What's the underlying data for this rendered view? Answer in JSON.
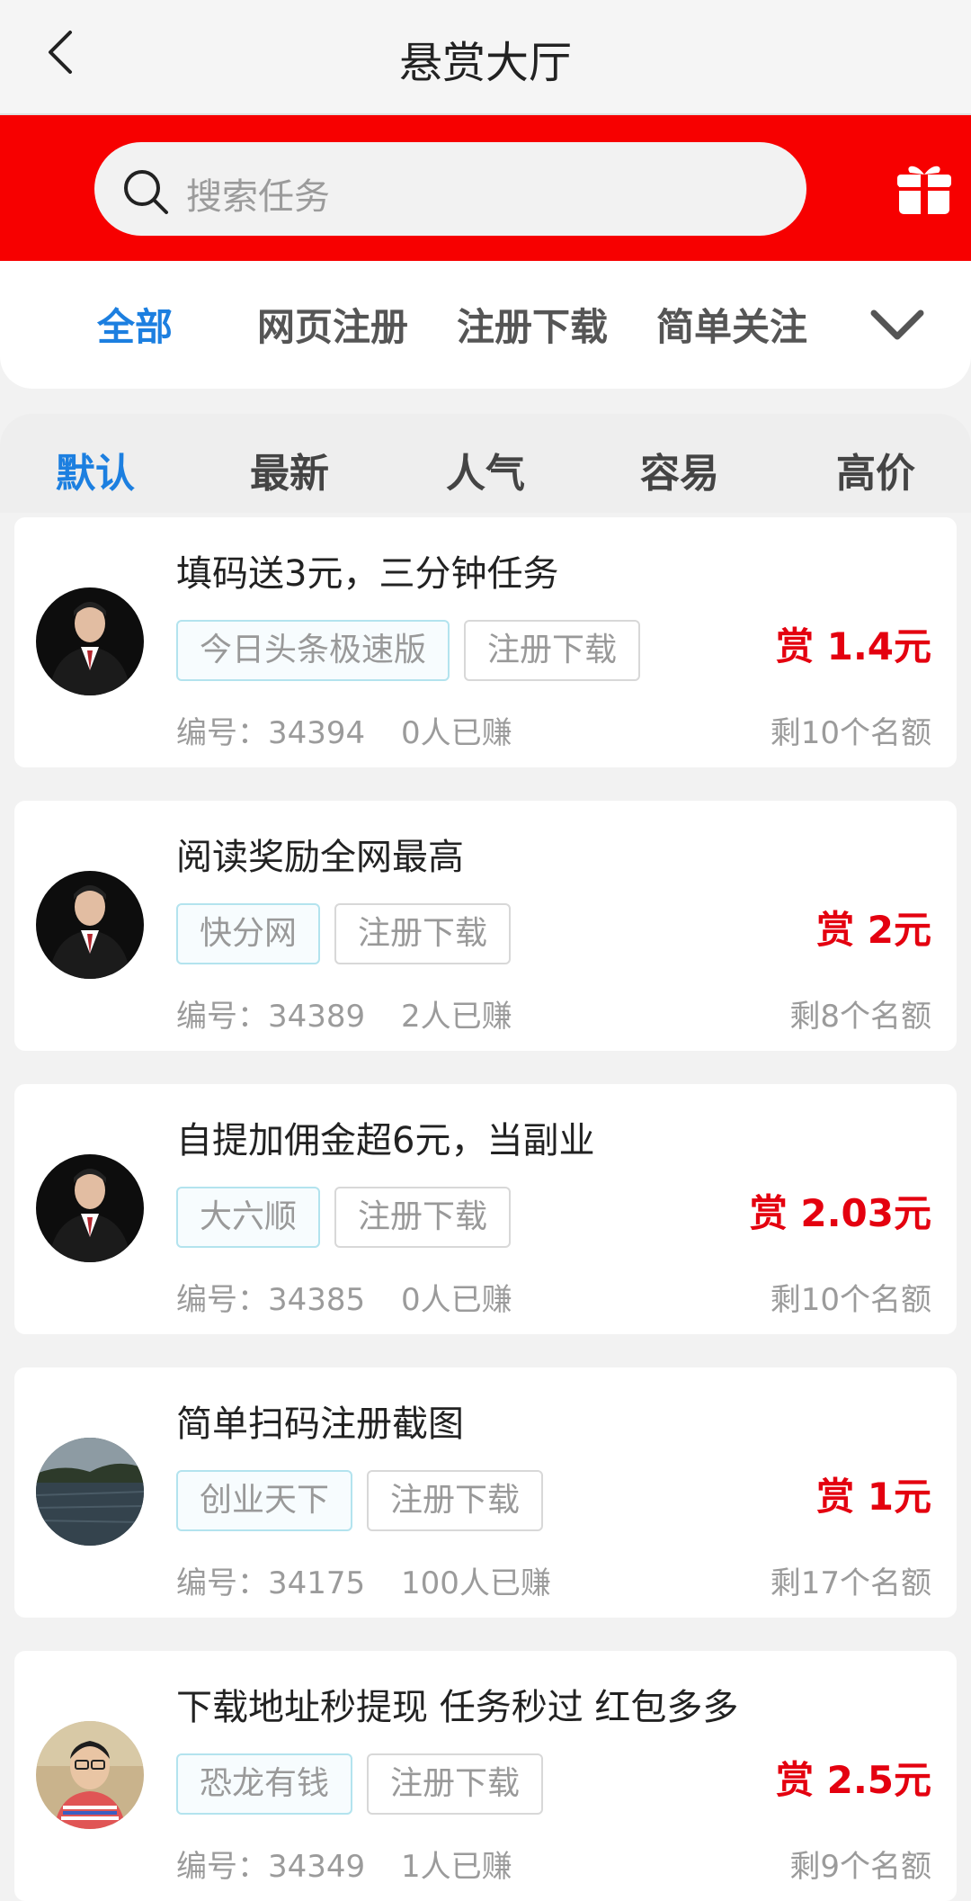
{
  "header": {
    "title": "悬赏大厅"
  },
  "search": {
    "placeholder": "搜索任务"
  },
  "categories": {
    "items": [
      {
        "label": "全部",
        "active": true
      },
      {
        "label": "网页注册",
        "active": false
      },
      {
        "label": "注册下载",
        "active": false
      },
      {
        "label": "简单关注",
        "active": false
      }
    ]
  },
  "sort": {
    "items": [
      {
        "label": "默认",
        "active": true
      },
      {
        "label": "最新",
        "active": false
      },
      {
        "label": "人气",
        "active": false
      },
      {
        "label": "容易",
        "active": false
      },
      {
        "label": "高价",
        "active": false
      }
    ]
  },
  "tasks": [
    {
      "title": "填码送3元，三分钟任务",
      "app_tag": "今日头条极速版",
      "type_tag": "注册下载",
      "reward": "赏 1.4元",
      "id_text": "编号：34394",
      "earned": "0人已赚",
      "remaining": "剩10个名额",
      "avatar": "man-suit"
    },
    {
      "title": "阅读奖励全网最高",
      "app_tag": "快分网",
      "type_tag": "注册下载",
      "reward": "赏 2元",
      "id_text": "编号：34389",
      "earned": "2人已赚",
      "remaining": "剩8个名额",
      "avatar": "man-suit"
    },
    {
      "title": "自提加佣金超6元，当副业",
      "app_tag": "大六顺",
      "type_tag": "注册下载",
      "reward": "赏 2.03元",
      "id_text": "编号：34385",
      "earned": "0人已赚",
      "remaining": "剩10个名额",
      "avatar": "man-suit"
    },
    {
      "title": "简单扫码注册截图",
      "app_tag": "创业天下",
      "type_tag": "注册下载",
      "reward": "赏 1元",
      "id_text": "编号：34175",
      "earned": "100人已赚",
      "remaining": "剩17个名额",
      "avatar": "lake"
    },
    {
      "title": "下载地址秒提现 任务秒过 红包多多",
      "app_tag": "恐龙有钱",
      "type_tag": "注册下载",
      "reward": "赏 2.5元",
      "id_text": "编号：34349",
      "earned": "1人已赚",
      "remaining": "剩9个名额",
      "avatar": "boy"
    }
  ],
  "colors": {
    "brand_red": "#f70000",
    "accent_blue": "#1c7fe0",
    "reward_red": "#e4000f"
  },
  "icons": [
    "back-icon",
    "search-icon",
    "gift-icon",
    "chevron-down-icon"
  ]
}
